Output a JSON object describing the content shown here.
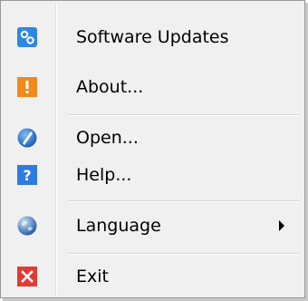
{
  "menu": {
    "items": [
      {
        "label": "Software Updates",
        "icon": "software-updates-icon"
      },
      {
        "label": "About...",
        "icon": "about-warning-icon"
      },
      {
        "label": "Open...",
        "icon": "open-icon"
      },
      {
        "label": "Help...",
        "icon": "help-icon"
      },
      {
        "label": "Language",
        "icon": "globe-icon",
        "has_submenu": true
      },
      {
        "label": "Exit",
        "icon": "exit-icon"
      }
    ]
  },
  "colors": {
    "menu_background": "#f0f0f0",
    "menu_border": "#979797",
    "updates_icon": "#2f86e6",
    "about_icon": "#f08a1c",
    "help_icon": "#2f7be0",
    "exit_icon": "#e03c31"
  }
}
